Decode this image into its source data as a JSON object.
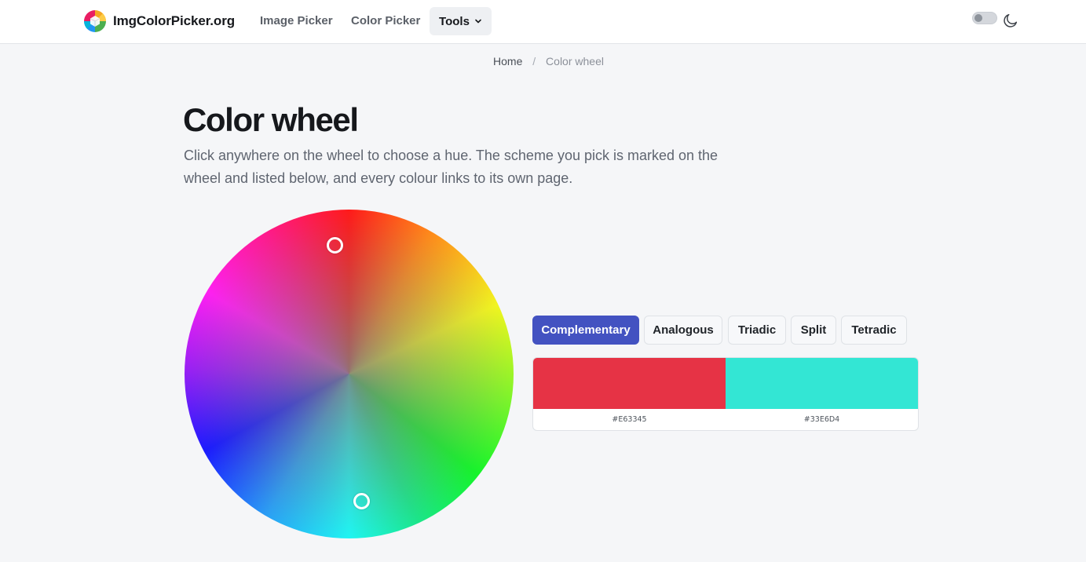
{
  "nav": {
    "brand": "ImgColorPicker.org",
    "links": [
      "Image Picker",
      "Color Picker"
    ],
    "tools_label": "Tools"
  },
  "breadcrumb": {
    "home": "Home",
    "separator": "/",
    "current": "Color wheel"
  },
  "page": {
    "title": "Color wheel",
    "description": "Click anywhere on the wheel to choose a hue. The scheme you pick is marked on the wheel and listed below, and every colour links to its own page."
  },
  "schemes": {
    "tabs": [
      "Complementary",
      "Analogous",
      "Triadic",
      "Split",
      "Tetradic"
    ],
    "active": "Complementary"
  },
  "swatches": [
    {
      "hex": "#E63345",
      "color": "#E63345"
    },
    {
      "hex": "#33E6D4",
      "color": "#33E6D4"
    }
  ],
  "colors": {
    "accent": "#4352c1",
    "background": "#f5f6f8",
    "marker": "#ffffff"
  },
  "icons": [
    "logo-icon",
    "chevron-down-icon",
    "moon-icon"
  ]
}
